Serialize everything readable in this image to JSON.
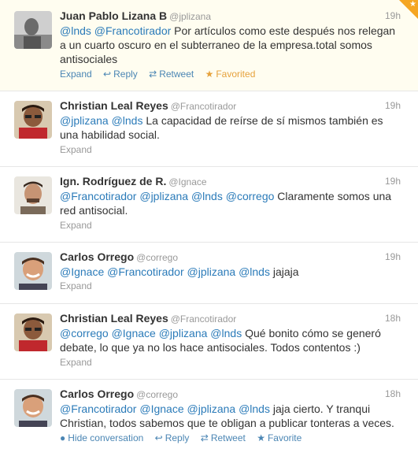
{
  "tweets": [
    {
      "name": "Juan Pablo Lizana B",
      "handle": "@jplizana",
      "time": "19h",
      "mentions": [
        "@lnds",
        "@Francotirador"
      ],
      "text_line1": " Por artículos como este después nos relegan",
      "text_line2": "a un cuarto oscuro en el subterraneo de la empresa.total somos",
      "text_line3": "antisociales",
      "actions": {
        "expand": "Expand",
        "reply": "Reply",
        "retweet": "Retweet",
        "favorite": "Favorited"
      }
    },
    {
      "name": "Christian Leal Reyes",
      "handle": "@Francotirador",
      "time": "19h",
      "mentions": [
        "@jplizana",
        "@lnds"
      ],
      "text_line1": " La capacidad de reírse de sí mismos también es",
      "text_line2": "una habilidad social.",
      "actions": {
        "expand": "Expand"
      }
    },
    {
      "name": "Ign. Rodríguez de R.",
      "handle": "@Ignace",
      "time": "19h",
      "mentions": [
        "@Francotirador",
        "@jplizana",
        "@lnds",
        "@corrego"
      ],
      "text_line1": " Claramente somos una",
      "text_line2": "red antisocial.",
      "actions": {
        "expand": "Expand"
      }
    },
    {
      "name": "Carlos Orrego",
      "handle": "@corrego",
      "time": "19h",
      "mentions": [
        "@Ignace",
        "@Francotirador",
        "@jplizana",
        "@lnds"
      ],
      "text_line1": " jajaja",
      "actions": {
        "expand": "Expand"
      }
    },
    {
      "name": "Christian Leal Reyes",
      "handle": "@Francotirador",
      "time": "18h",
      "mentions": [
        "@corrego",
        "@Ignace",
        "@jplizana",
        "@lnds"
      ],
      "text_line1": " Qué bonito cómo se generó",
      "text_line2": "debate, lo que ya no los hace antisociales. Todos contentos :)",
      "actions": {
        "expand": "Expand"
      }
    },
    {
      "name": "Carlos Orrego",
      "handle": "@corrego",
      "time": "18h",
      "mentions": [
        "@Francotirador",
        "@Ignace",
        "@jplizana",
        "@lnds"
      ],
      "text_line1": " jaja cierto. Y tranqui",
      "text_line2": "Christian, todos sabemos que te obligan a publicar tonteras a veces.",
      "actions": {
        "hide": "Hide conversation",
        "reply": "Reply",
        "retweet": "Retweet",
        "favorite": "Favorite"
      }
    }
  ],
  "icons": {
    "reply": "reply-arrow-icon",
    "retweet": "retweet-icon",
    "favorite": "star-icon",
    "hide": "conversation-bubble-icon"
  },
  "colors": {
    "link": "#2b7bb9",
    "favorited": "#e6a23c",
    "meta": "#999999",
    "name": "#333333"
  }
}
